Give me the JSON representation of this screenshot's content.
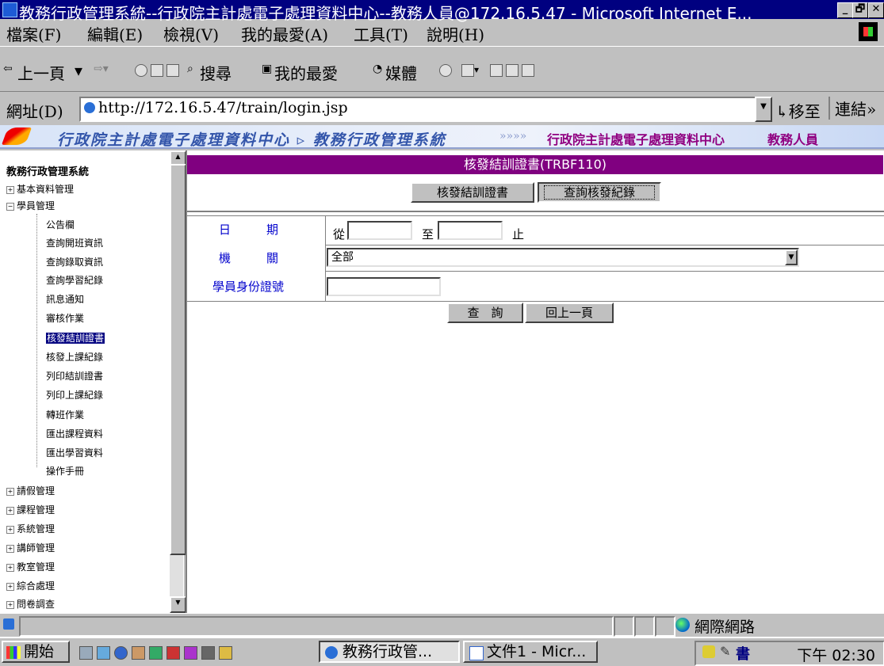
{
  "window": {
    "title": "教務行政管理系統--行政院主計處電子處理資料中心--教務人員@172.16.5.47 - Microsoft Internet E...",
    "controls": [
      "_",
      "🗗",
      "✕"
    ]
  },
  "menu": [
    "檔案(F)",
    "編輯(E)",
    "檢視(V)",
    "我的最愛(A)",
    "工具(T)",
    "說明(H)"
  ],
  "toolbar": {
    "back": "上一頁",
    "search": "搜尋",
    "favorites": "我的最愛",
    "media": "媒體"
  },
  "address": {
    "label": "網址(D)",
    "url": "http://172.16.5.47/train/login.jsp",
    "go": "移至",
    "links": "連結"
  },
  "banner": {
    "left": "行政院主計處電子處理資料中心 ▹ 教務行政管理系統",
    "org": "行政院主計處電子處理資料中心",
    "role": "教務人員"
  },
  "tree": {
    "title": "教務行政管理系統",
    "items": [
      {
        "label": "基本資料管理",
        "pm": "+"
      },
      {
        "label": "學員管理",
        "pm": "−"
      },
      {
        "label": "公告欄"
      },
      {
        "label": "查詢開班資訊"
      },
      {
        "label": "查詢錄取資訊"
      },
      {
        "label": "查詢學習紀錄"
      },
      {
        "label": "訊息通知"
      },
      {
        "label": "審核作業"
      },
      {
        "label": "核發結訓證書"
      },
      {
        "label": "核發上課紀錄"
      },
      {
        "label": "列印結訓證書"
      },
      {
        "label": "列印上課紀錄"
      },
      {
        "label": "轉班作業"
      },
      {
        "label": "匯出課程資料"
      },
      {
        "label": "匯出學習資料"
      },
      {
        "label": "操作手冊"
      },
      {
        "label": "請假管理",
        "pm": "+"
      },
      {
        "label": "課程管理",
        "pm": "+"
      },
      {
        "label": "系統管理",
        "pm": "+"
      },
      {
        "label": "講師管理",
        "pm": "+"
      },
      {
        "label": "教室管理",
        "pm": "+"
      },
      {
        "label": "綜合處理",
        "pm": "+"
      },
      {
        "label": "問卷調查",
        "pm": "+"
      }
    ]
  },
  "page": {
    "title": "核發結訓證書(TRBF110)",
    "tab_issue": "核發結訓證書",
    "tab_query": "查詢核發紀錄",
    "date_label": "日　　　期",
    "from": "從",
    "to": "至",
    "end": "止",
    "org_label": "機　　　關",
    "org_value": "全部",
    "id_label": "學員身份證號",
    "query_btn": "查　詢",
    "back_btn": "回上一頁"
  },
  "status": {
    "zone": "網際網路"
  },
  "taskbar": {
    "start": "開始",
    "task1": "教務行政管...",
    "task2": "文件1 - Micr...",
    "tray_ime": "書",
    "clock": "下午 02:30"
  }
}
